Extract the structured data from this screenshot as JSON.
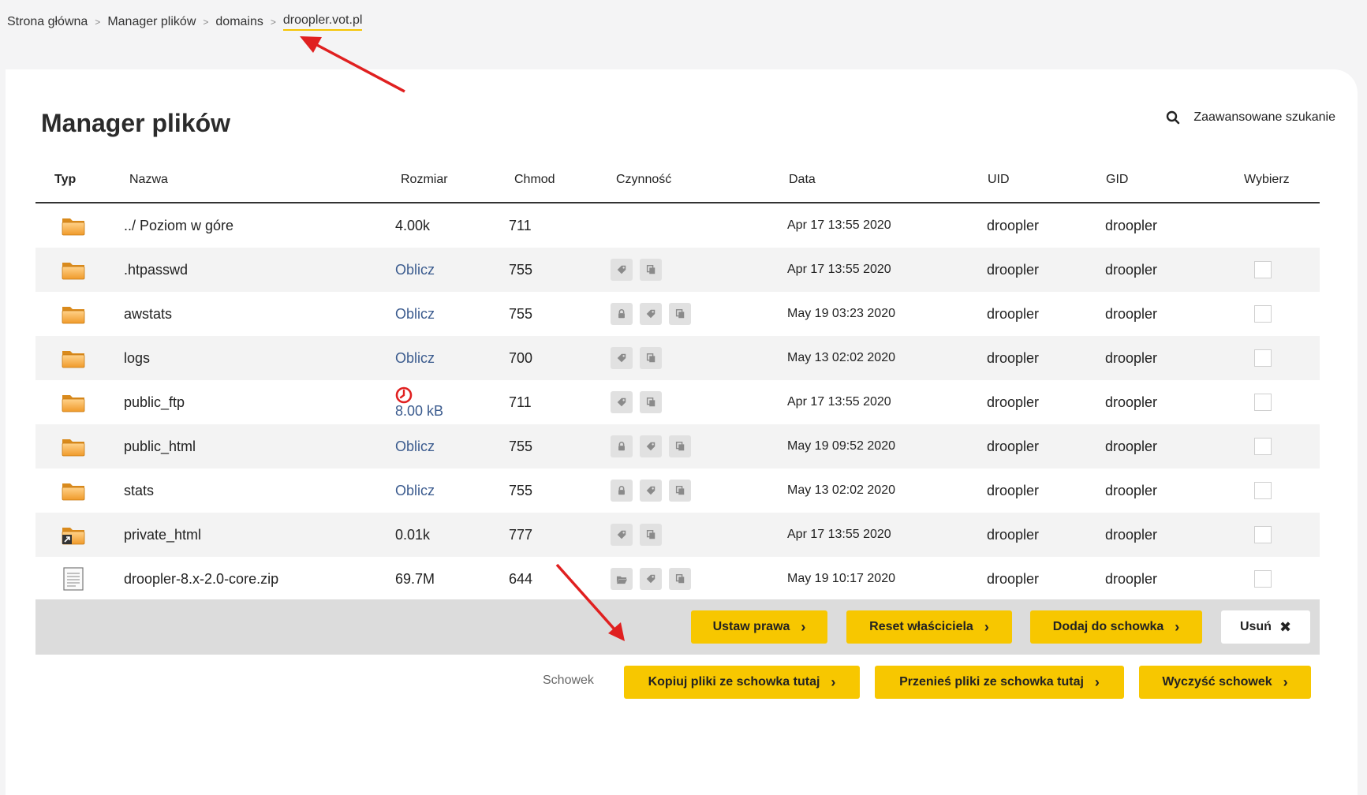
{
  "breadcrumb": {
    "items": [
      "Strona główna",
      "Manager plików",
      "domains"
    ],
    "current": "droopler.vot.pl"
  },
  "page": {
    "title": "Manager plików",
    "advanced_search": "Zaawansowane szukanie"
  },
  "table": {
    "headers": {
      "typ": "Typ",
      "nazwa": "Nazwa",
      "rozmiar": "Rozmiar",
      "chmod": "Chmod",
      "czynnosc": "Czynność",
      "data": "Data",
      "uid": "UID",
      "gid": "GID",
      "wybierz": "Wybierz"
    },
    "rows": [
      {
        "name": "../ Poziom w góre",
        "size": "4.00k",
        "chmod": "711",
        "date": "Apr 17 13:55 2020",
        "uid": "droopler",
        "gid": "droopler"
      },
      {
        "name": ".htpasswd",
        "size": "Oblicz",
        "chmod": "755",
        "date": "Apr 17 13:55 2020",
        "uid": "droopler",
        "gid": "droopler"
      },
      {
        "name": "awstats",
        "size": "Oblicz",
        "chmod": "755",
        "date": "May 19 03:23 2020",
        "uid": "droopler",
        "gid": "droopler"
      },
      {
        "name": "logs",
        "size": "Oblicz",
        "chmod": "700",
        "date": "May 13 02:02 2020",
        "uid": "droopler",
        "gid": "droopler"
      },
      {
        "name": "public_ftp",
        "size": "8.00 kB",
        "chmod": "711",
        "date": "Apr 17 13:55 2020",
        "uid": "droopler",
        "gid": "droopler"
      },
      {
        "name": "public_html",
        "size": "Oblicz",
        "chmod": "755",
        "date": "May 19 09:52 2020",
        "uid": "droopler",
        "gid": "droopler"
      },
      {
        "name": "stats",
        "size": "Oblicz",
        "chmod": "755",
        "date": "May 13 02:02 2020",
        "uid": "droopler",
        "gid": "droopler"
      },
      {
        "name": "private_html",
        "size": "0.01k",
        "chmod": "777",
        "date": "Apr 17 13:55 2020",
        "uid": "droopler",
        "gid": "droopler"
      },
      {
        "name": "droopler-8.x-2.0-core.zip",
        "size": "69.7M",
        "chmod": "644",
        "date": "May 19 10:17 2020",
        "uid": "droopler",
        "gid": "droopler"
      }
    ]
  },
  "actions": {
    "ustaw_prawa": "Ustaw prawa",
    "reset_wlasciciela": "Reset właściciela",
    "dodaj_do_schowka": "Dodaj do schowka",
    "usun": "Usuń"
  },
  "clipboard": {
    "label": "Schowek",
    "kopiuj": "Kopiuj pliki ze schowka tutaj",
    "przenies": "Przenieś pliki ze schowka tutaj",
    "wyczysc": "Wyczyść schowek"
  },
  "colors": {
    "accent": "#f7c700",
    "link": "#3b5b8e",
    "annotation": "#e02020",
    "folder": "#f0a030"
  }
}
